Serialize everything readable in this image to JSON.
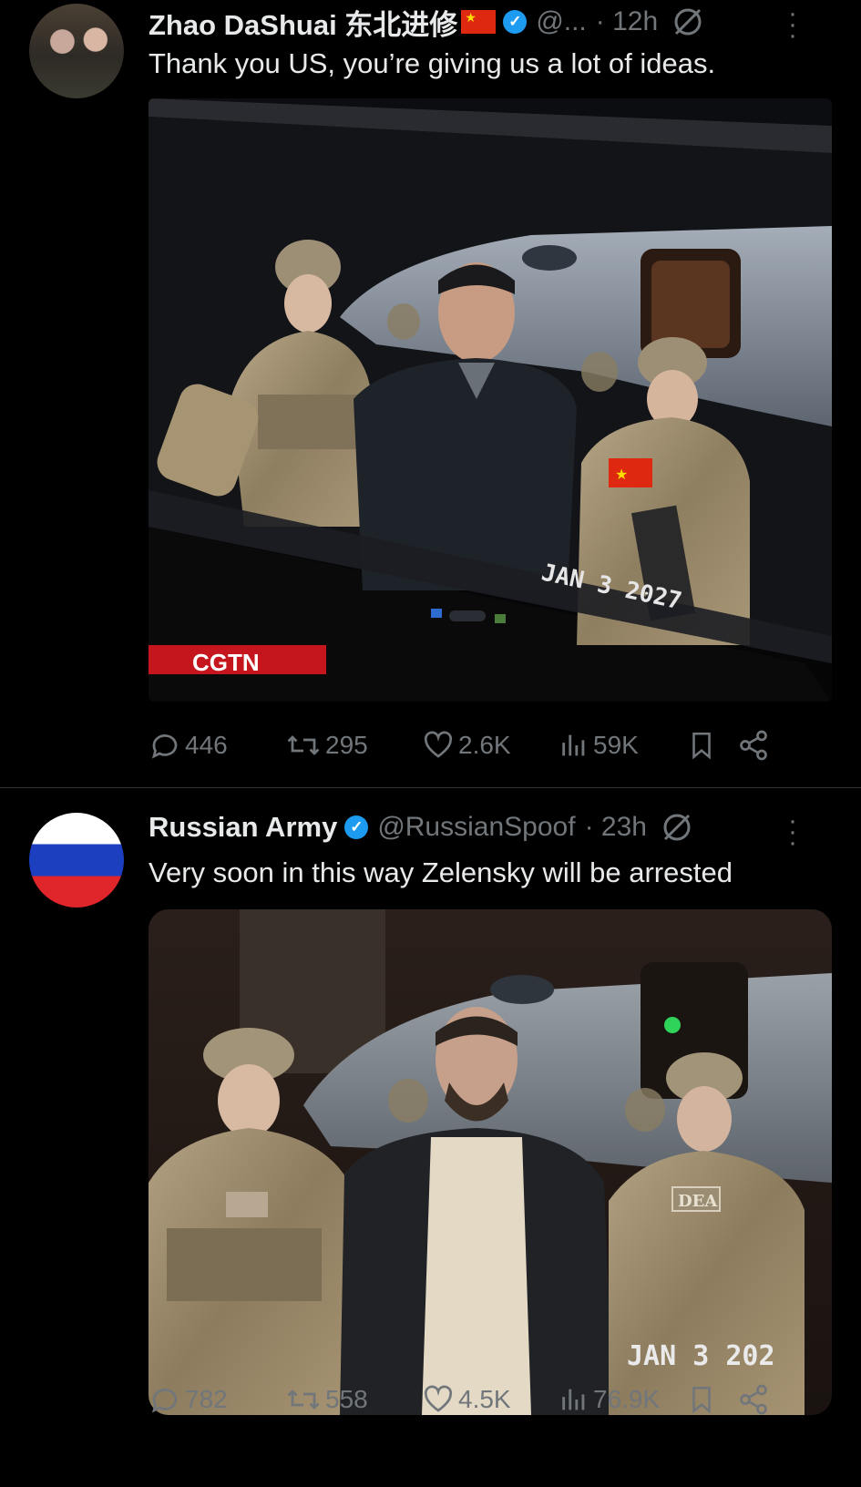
{
  "tweets": [
    {
      "name": "Zhao DaShuai 东北进修",
      "handle": "@...",
      "time": "· 12h",
      "text": "Thank you US, you’re giving us a lot of ideas.",
      "media_caption": "CGTN",
      "media_stamp": "JAN 3 2027",
      "replies": "446",
      "reposts": "295",
      "likes": "2.6K",
      "views": "59K"
    },
    {
      "name": "Russian Army",
      "handle": "@RussianSpoof",
      "time": "· 23h",
      "text": "Very soon  in this way Zelensky will be arrested",
      "media_stamp": "JAN 3 202",
      "replies": "782",
      "reposts": "558",
      "likes": "4.5K",
      "views": "76.9K"
    }
  ],
  "colors": {
    "verified": "#1d9bf0",
    "muted": "#71767b",
    "text": "#e7e9ea",
    "cgtn": "#c4161c"
  },
  "icons": [
    "verified-icon",
    "grok-icon",
    "more-icon",
    "reply-icon",
    "repost-icon",
    "like-icon",
    "views-icon",
    "bookmark-icon",
    "share-icon"
  ]
}
